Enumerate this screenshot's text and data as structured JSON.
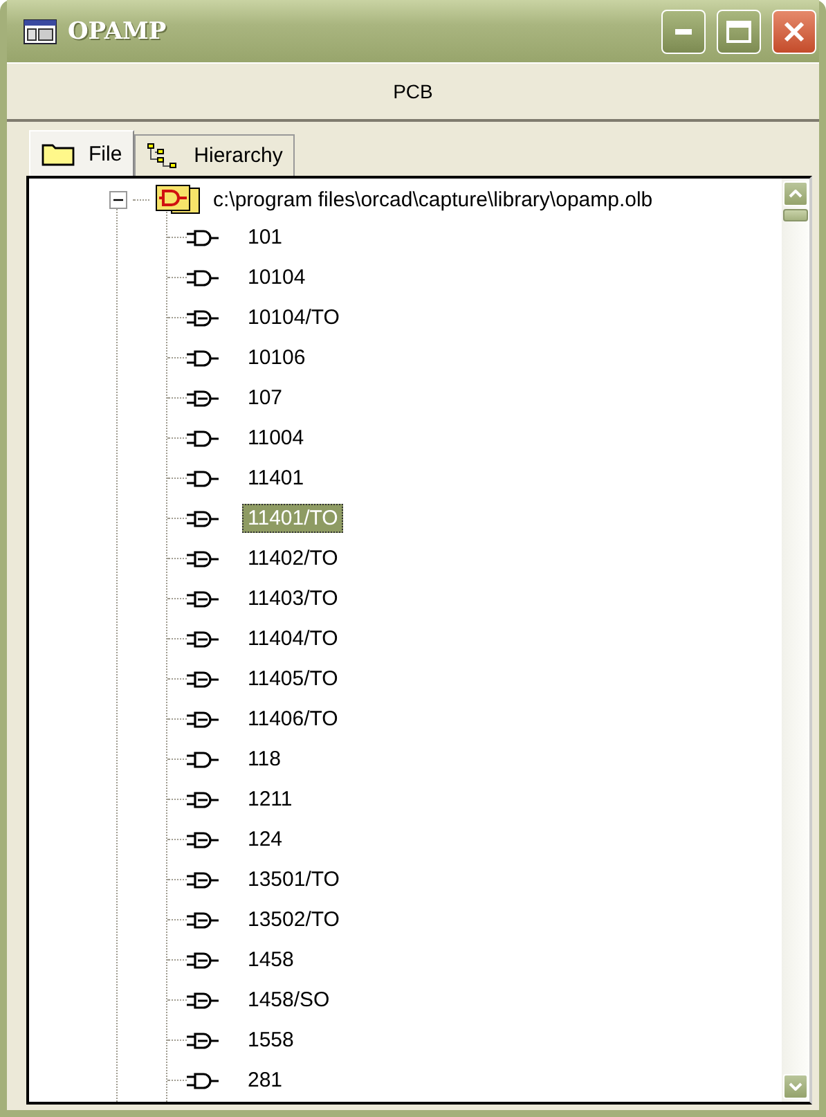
{
  "window": {
    "title": "OPAMP"
  },
  "header": {
    "label": "PCB"
  },
  "tabs": [
    {
      "label": "File",
      "selected": true,
      "kind": "folder"
    },
    {
      "label": "Hierarchy",
      "selected": false,
      "kind": "hierarchy"
    }
  ],
  "tree": {
    "root": {
      "label": "c:\\program files\\orcad\\capture\\library\\opamp.olb",
      "expanded": true,
      "children": [
        {
          "label": "101",
          "kind": "single",
          "selected": false
        },
        {
          "label": "10104",
          "kind": "single",
          "selected": false
        },
        {
          "label": "10104/TO",
          "kind": "multi",
          "selected": false
        },
        {
          "label": "10106",
          "kind": "single",
          "selected": false
        },
        {
          "label": "107",
          "kind": "multi",
          "selected": false
        },
        {
          "label": "11004",
          "kind": "single",
          "selected": false
        },
        {
          "label": "11401",
          "kind": "single",
          "selected": false
        },
        {
          "label": "11401/TO",
          "kind": "multi",
          "selected": true
        },
        {
          "label": "11402/TO",
          "kind": "multi",
          "selected": false
        },
        {
          "label": "11403/TO",
          "kind": "multi",
          "selected": false
        },
        {
          "label": "11404/TO",
          "kind": "multi",
          "selected": false
        },
        {
          "label": "11405/TO",
          "kind": "multi",
          "selected": false
        },
        {
          "label": "11406/TO",
          "kind": "multi",
          "selected": false
        },
        {
          "label": "118",
          "kind": "single",
          "selected": false
        },
        {
          "label": "1211",
          "kind": "multi",
          "selected": false
        },
        {
          "label": "124",
          "kind": "multi",
          "selected": false
        },
        {
          "label": "13501/TO",
          "kind": "multi",
          "selected": false
        },
        {
          "label": "13502/TO",
          "kind": "multi",
          "selected": false
        },
        {
          "label": "1458",
          "kind": "multi",
          "selected": false
        },
        {
          "label": "1458/SO",
          "kind": "multi",
          "selected": false
        },
        {
          "label": "1558",
          "kind": "multi",
          "selected": false
        },
        {
          "label": "281",
          "kind": "single",
          "selected": false
        }
      ]
    }
  }
}
